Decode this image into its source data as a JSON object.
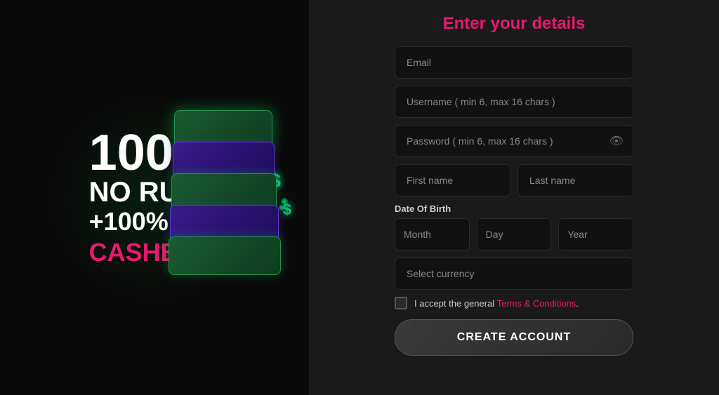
{
  "left": {
    "line1": "100%",
    "line2": "NO RULES",
    "line3_prefix": "+100%",
    "line3_suffix": "CASHBACK"
  },
  "form": {
    "title": "Enter your details",
    "email_placeholder": "Email",
    "username_placeholder": "Username ( min 6, max 16 chars )",
    "password_placeholder": "Password ( min 6, max 16 chars )",
    "firstname_placeholder": "First name",
    "lastname_placeholder": "Last name",
    "dob_label": "Date Of Birth",
    "month_placeholder": "Month",
    "day_placeholder": "Day",
    "year_placeholder": "Year",
    "currency_placeholder": "Select currency",
    "terms_text": "I accept the general ",
    "terms_link": "Terms & Conditions",
    "terms_period": ".",
    "create_btn": "CREATE ACCOUNT"
  }
}
